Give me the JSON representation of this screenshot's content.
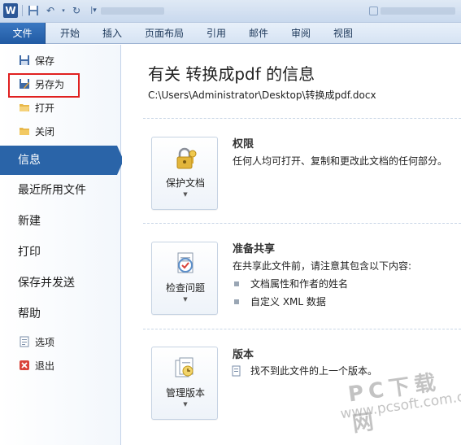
{
  "titlebar": {
    "app_icon": "W"
  },
  "tabs": [
    "文件",
    "开始",
    "插入",
    "页面布局",
    "引用",
    "邮件",
    "审阅",
    "视图"
  ],
  "left_small_top": [
    {
      "label": "保存",
      "icon": "save-icon"
    },
    {
      "label": "另存为",
      "icon": "save-as-icon"
    },
    {
      "label": "打开",
      "icon": "open-folder-icon"
    },
    {
      "label": "关闭",
      "icon": "close-folder-icon"
    }
  ],
  "left_big": [
    "信息",
    "最近所用文件",
    "新建",
    "打印",
    "保存并发送",
    "帮助"
  ],
  "left_small_bottom": [
    {
      "label": "选项",
      "icon": "options-icon"
    },
    {
      "label": "退出",
      "icon": "exit-icon"
    }
  ],
  "main": {
    "title": "有关 转换成pdf 的信息",
    "path": "C:\\Users\\Administrator\\Desktop\\转换成pdf.docx",
    "sections": [
      {
        "button": "保护文档",
        "title": "权限",
        "desc": "任何人均可打开、复制和更改此文档的任何部分。"
      },
      {
        "button": "检查问题",
        "title": "准备共享",
        "desc": "在共享此文件前，请注意其包含以下内容:",
        "bullets": [
          "文档属性和作者的姓名",
          "自定义 XML 数据"
        ]
      },
      {
        "button": "管理版本",
        "title": "版本",
        "desc": "找不到此文件的上一个版本。"
      }
    ]
  },
  "watermark": {
    "text": "PC下载网",
    "url": "www.pcsoft.com.cn"
  },
  "colors": {
    "accent": "#2a64a8",
    "highlight_box": "#e02020"
  }
}
